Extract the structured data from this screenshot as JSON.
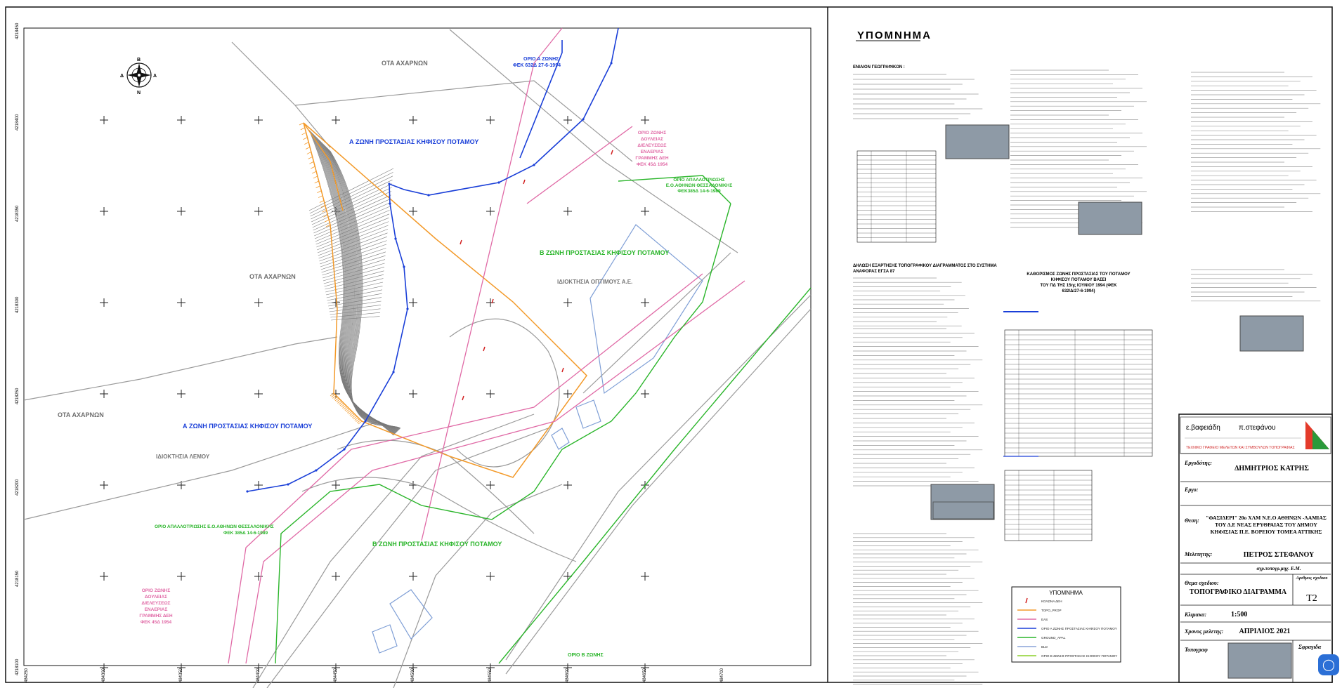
{
  "map": {
    "y_ticks": [
      "4218450",
      "4218400",
      "4218350",
      "4218300",
      "4218250",
      "4218200",
      "4218150",
      "4218100"
    ],
    "x_ticks": [
      "484250",
      "484300",
      "484350",
      "484400",
      "484450",
      "484500",
      "484550",
      "484600",
      "484650",
      "484700"
    ],
    "labels": {
      "ota_top": "ΟΤΑ ΑΧΑΡΝΩΝ",
      "ota_mid": "ΟΤΑ ΑΧΑΡΝΩΝ",
      "ota_low": "ΟΤΑ ΑΧΑΡΝΩΝ",
      "zone_a_top": "Α ΖΩΝΗ ΠΡΟΣΤΑΣΙΑΣ ΚΗΦΙΣΟΥ ΠΟΤΑΜΟΥ",
      "zone_a_bottom": "Α ΖΩΝΗ ΠΡΟΣΤΑΣΙΑΣ ΚΗΦΙΣΟΥ ΠΟΤΑΜΟΥ",
      "zone_b_right": "Β ΖΩΝΗ ΠΡΟΣΤΑΣΙΑΣ ΚΗΦΙΣΟΥ ΠΟΤΑΜΟΥ",
      "zone_b_bottom": "Β ΖΩΝΗ ΠΡΟΣΤΑΣΙΑΣ ΚΗΦΙΣΟΥ ΠΟΤΑΜΟΥ",
      "optimus": "ΙΔΙΟΚΤΗΣΙΑ ΟΠΤΙΜΟΥΣ Α.Ε.",
      "lemou": "ΙΔΙΟΚΤΗΣΙΑ ΛΕΜΟΥ",
      "orio_a_line1": "ΟΡΙΟ Α ΖΩΝΗΣ",
      "orio_a_line2": "ΦΕΚ 632Δ 27-6-1994",
      "dei_line1": "ΟΡΙΟ ΖΩΝΗΣ",
      "dei_line2": "ΔΟΥΛΕΙΑΣ",
      "dei_line3": "ΔΙΕΛΕΥΣΕΩΣ",
      "dei_line4": "ΕΝΑΕΡΙΑΣ",
      "dei_line5": "ΓΡΑΜΜΗΣ ΔΕΗ",
      "dei_line6": "ΦΕΚ 45Δ 1954",
      "apall_right_line1": "ΟΡΙΟ ΑΠΑΛΛΟΤΡΙΩΣΗΣ",
      "apall_right_line2": "Ε.Ο.ΑΘΗΝΩΝ ΘΕΣΣΑΛΟΝΙΚΗΣ",
      "apall_right_line3": "ΦΕΚ385Δ 14-6-1989",
      "apall_left_line1": "ΟΡΙΟ ΑΠΑΛΛΟΤΡΙΩΣΗΣ Ε.Ο.ΑΘΗΝΩΝ ΘΕΣΣΑΛΟΝΙΚΗΣ",
      "apall_left_line2": "ΦΕΚ 385Δ 14-6-1989",
      "orio_b": "ΟΡΙΟ Β ΖΩΝΗΣ"
    },
    "compass": {
      "n": "Β",
      "s": "Ν",
      "e": "Α",
      "w": "Δ"
    }
  },
  "legend": {
    "title": "ΥΠΟΜΝΗΜΑ",
    "sections": {
      "general": "ΕΝΙΑΙΟΝ ΓΕΩΓΡΑΦΙΚΟΝ :",
      "zone_def_line1": "ΚΑΘΟΡΙΣΜΟΣ ΖΩΝΗΣ  ΠΡΟΣΤΑΣΙΑΣ ΤΟΥ ΠΟΤΑΜΟΥ",
      "zone_def_line2": "ΚΗΦΙΣΟΥ ΠΟΤΑΜΟΥ ΒΑΣΕΙ",
      "zone_def_line3": "ΤΟΥ ΠΔ ΤΗΣ 15ης ΙΟΥΝΙΟΥ 1994 (ΦΕΚ",
      "zone_def_line4": "632/Δ/27-6-1994)",
      "declaration_line1": "ΔΗΛΩΣΗ ΕΞΑΡΤΗΣΗΣ ΤΟΠΟΓΡΑΦΙΚΟΥ ΔΙΑΓΡΑΜΜΑΤΟΣ ΣΤΟ ΣΥΣΤΗΜΑ",
      "declaration_line2": "ΑΝΑΦΟΡΑΣ ΕΓΣΑ 87"
    },
    "symbols_title": "ΥΠΟΜΝΗΜΑ",
    "symbols": [
      {
        "label": "ΚΟΛΩΝΑ ΔΕΗ",
        "color": "#d22020"
      },
      {
        "label": "TOPO_PROP",
        "color": "#f39a2a"
      },
      {
        "label": "EAS",
        "color": "#e06aa6"
      },
      {
        "label": "ΟΡΙΟ Α ΖΩΝΗΣ ΠΡΟΣΤΑΣΙΑΣ ΚΗΦΙΣΟΥ ΠΟΤΑΜΟΥ",
        "color": "#1a3fd8"
      },
      {
        "label": "GROUND_APAL",
        "color": "#2ab52a"
      },
      {
        "label": "BLD",
        "color": "#8aa3d8"
      },
      {
        "label": "ΟΡΙΟ Β ΖΩΝΗΣ ΠΡΟΣΤΑΣΙΑΣ ΚΗΦΙΣΟΥ ΠΟΤΑΜΟΥ",
        "color": "#8bd12a"
      }
    ]
  },
  "title_block": {
    "firm_name_left": "ε.βαφειάδη",
    "firm_name_right": "π.στεφάνου",
    "firm_tagline": "ΤΕΧΝΙΚΟ ΓΡΑΦΕΙΟ ΜΕΛΕΤΩΝ ΚΑΙ ΣΥΜΒΟΥΛΩΝ ΤΟΠΟΓΡΑΦΙΑΣ",
    "rows": [
      {
        "label": "Εργοδότης:",
        "value": "ΔΗΜΗΤΡΙΟΣ ΚΑΤΡΗΣ"
      },
      {
        "label": "Εργο:",
        "value": ""
      },
      {
        "label": "Θεση:",
        "value": "\"ΦΑΣΙΔΕΡΙ\" 20ο ΧΛΜ Ν.Ε.Ο ΑΘΗΝΩΝ -ΛΑΜΙΑΣ ΤΟΥ Δ.Ε ΝΕΑΣ ΕΡΥΘΡΑΙΑΣ ΤΟΥ ΔΗΜΟΥ ΚΗΦΙΣΙΑΣ Π.Ε. ΒΟΡΕΙΟΥ ΤΟΜΕΑ ΑΤΤΙΚΗΣ"
      },
      {
        "label": "Μελετητης:",
        "value": "ΠΕΤΡΟΣ ΣΤΕΦΑΝΟΥ"
      },
      {
        "label": "Θεμα σχεδιου:",
        "value": "ΤΟΠΟΓΡΑΦΙΚΟ ΔΙΑΓΡΑΜΜΑ"
      },
      {
        "label": "Κλιμακα:",
        "value": "1:500"
      },
      {
        "label": "Χρονος μελετης:",
        "value": "ΑΠΡΙΛΙΟΣ 2021"
      },
      {
        "label": "Τοπογραφ",
        "value": ""
      }
    ],
    "subtitle": "αγρ.τοπογρ.μηχ. Ε.Μ.",
    "drawing_no_label": "Αριθμος σχεδιου",
    "drawing_no": "Τ2",
    "signatures_label": "Σφραγιδα"
  },
  "colors": {
    "zone_a": "#1a3fd8",
    "zone_b": "#2ab52a",
    "dei": "#e06aa6",
    "property": "#f39a2a",
    "building": "#7f9fd6",
    "stamp": "#8e9aa6"
  }
}
